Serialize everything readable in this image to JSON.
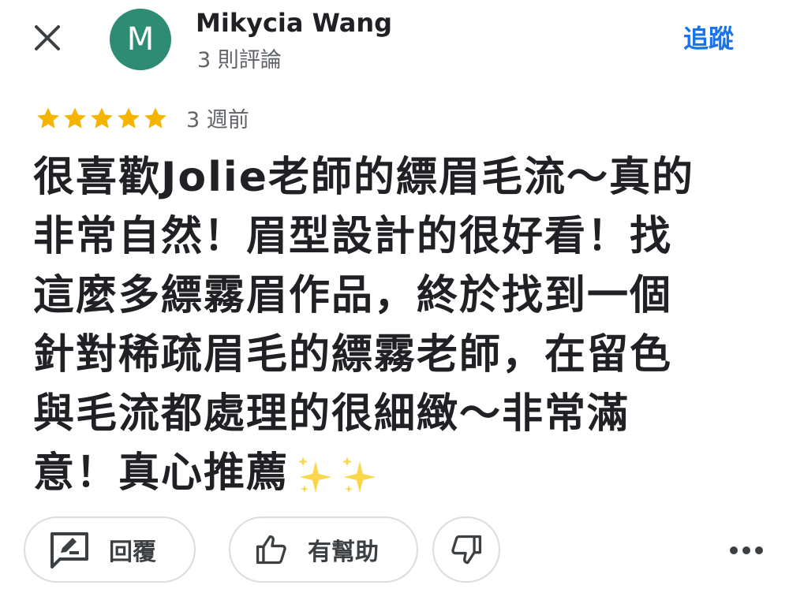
{
  "header": {
    "avatar_letter": "M",
    "avatar_color": "#2e8b74",
    "author_name": "Mikycia Wang",
    "author_meta": "3 則評論",
    "follow_label": "追蹤",
    "close_icon": "close-icon"
  },
  "rating": {
    "stars": 5,
    "max_stars": 5,
    "star_color": "#f4b400",
    "time_ago": "3 週前"
  },
  "review": {
    "lines": [
      "很喜歡Jolie老師的縹眉毛流～真的",
      "非常自然！眉型設計的很好看！找",
      "這麼多縹霧眉作品，終於找到一個",
      "針對稀疏眉毛的縹霧老師，在留色",
      "與毛流都處理的很細緻～非常滿",
      "意！真心推薦"
    ],
    "trailing_emoji": "sparkles-icon"
  },
  "actions": {
    "reply_label": "回覆",
    "helpful_label": "有幫助",
    "reply_icon": "reply-icon",
    "helpful_icon": "thumbs-up-icon",
    "dislike_icon": "thumbs-down-icon",
    "more_icon": "more-horiz-icon"
  },
  "colors": {
    "accent": "#1a73e8",
    "text_primary": "#202124",
    "text_secondary": "#5f6368",
    "border": "#dadce0"
  }
}
